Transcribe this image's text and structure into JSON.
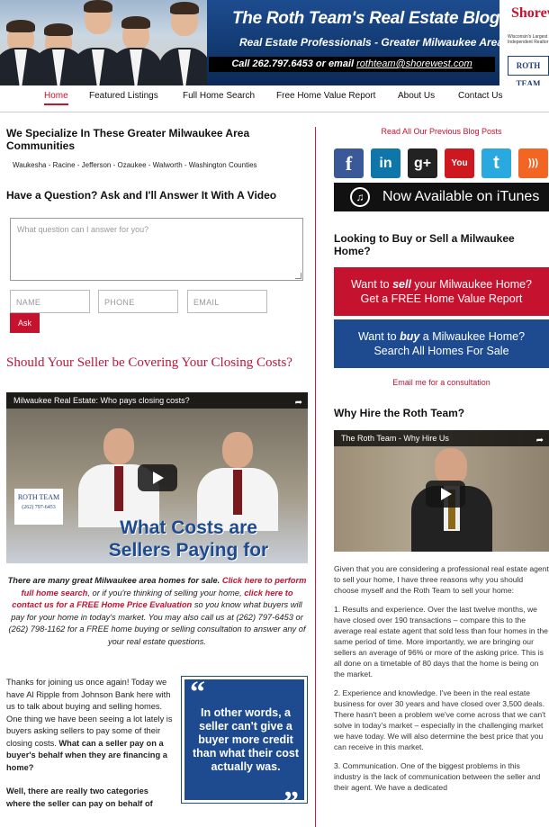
{
  "header": {
    "title": "The Roth Team's Real Estate Blog",
    "subtitle": "Real Estate Professionals - Greater Milwaukee Area",
    "call_prefix": "Call 262.797.6453 or email ",
    "email": "rothteam@shorewest.com",
    "brand_logo": "Shorew",
    "brand_tagline": "Wisconsin's Largest Independent Realtor",
    "team_badge": "ROTH TEAM"
  },
  "nav": {
    "items": [
      "Home",
      "Featured Listings",
      "Full Home Search",
      "Free Home Value Report",
      "About Us",
      "Contact Us"
    ],
    "active_index": 0
  },
  "left": {
    "specialize_heading": "We Specialize In These Greater Milwaukee Area Communities",
    "counties": "Waukesha - Racine - Jefferson - Ozaukee - Walworth - Washington Counties",
    "question_heading": "Have a Question? Ask and I'll Answer It With A Video",
    "question_placeholder": "What question can I answer for you?",
    "name_placeholder": "NAME",
    "phone_placeholder": "PHONE",
    "email_placeholder": "EMAIL",
    "ask_button": "Ask",
    "post_title": "Should Your Seller be Covering Your Closing Costs?",
    "video": {
      "title": "Milwaukee Real Estate: Who pays closing costs?",
      "logo_text": "ROTH TEAM",
      "logo_phone": "(262) 797-6453",
      "caption_line1": "What Costs are",
      "caption_line2": "Sellers Paying for Buyers?"
    },
    "promo": {
      "p1": "There are many great Milwaukee area homes for sale.",
      "link1": "Click here to perform full home search",
      "p2": ", or if you're thinking of selling your home,",
      "link2": "click here to contact us for a FREE Home Price Evaluation",
      "p3": " so you know what buyers will pay for your home in today's market. You may also call us at (262) 797-6453 or (262) 798-1162 for a FREE home buying or selling consultation to answer any of your real estate questions."
    },
    "body": {
      "p1": "Thanks for joining us once again! Today we have Al Ripple from Johnson Bank here with us to talk about buying and selling homes. One thing we have been seeing a lot lately is buyers asking sellers to pay some of their closing costs.",
      "p1_bold": "What can a seller pay on a buyer's behalf when they are financing a home?",
      "p2_bold": "Well, there are really two categories where the seller can pay on behalf of"
    },
    "quote": {
      "open": "“",
      "close": "”",
      "text": "In other words, a seller can't give a buyer more credit than what their cost actually was."
    }
  },
  "right": {
    "previous_posts": "Read All Our Previous Blog Posts",
    "social": [
      {
        "name": "facebook",
        "glyph": "f",
        "color": "#3b5998"
      },
      {
        "name": "linkedin",
        "glyph": "in",
        "color": "#0e76a8"
      },
      {
        "name": "google-plus",
        "glyph": "g+",
        "color": "#222222"
      },
      {
        "name": "youtube",
        "glyph": "You",
        "color": "#cc181e"
      },
      {
        "name": "twitter",
        "glyph": "t",
        "color": "#2aa9e0"
      },
      {
        "name": "rss",
        "glyph": ")))",
        "color": "#f26522"
      }
    ],
    "itunes_text": "Now Available on iTunes",
    "buy_sell_heading": "Looking to Buy or Sell a Milwaukee Home?",
    "sell_cta_a": "Want to ",
    "sell_cta_em": "sell",
    "sell_cta_b": " your Milwaukee Home?",
    "sell_cta_line2": "Get a FREE Home Value Report",
    "buy_cta_a": "Want to ",
    "buy_cta_em": "buy",
    "buy_cta_b": " a Milwaukee Home?",
    "buy_cta_line2": "Search All Homes For Sale",
    "email_link": "Email me for a consultation",
    "why_heading": "Why Hire the Roth Team?",
    "video_title": "The Roth Team - Why Hire Us",
    "paragraphs": [
      "Given that you are considering a professional real estate agent to sell your home, I have three reasons why you should choose myself and the Roth Team to sell your home:",
      "1. Results and experience. Over the last twelve months, we have closed over 190 transactions – compare this to the average real estate agent that sold less than four homes in the same period of time. More importantly, we are bringing our sellers an average of 96% or more of the asking price. This is all done on a timetable of 80 days that the home is being on the market.",
      "2. Experience and knowledge. I've been in the real estate business for over 30 years and have closed over 3,500 deals. There hasn't been a problem we've come across that we can't solve in today's market – especially in the challenging market we have today. We will also determine the best price that you can receive in this market.",
      "3. Communication. One of the biggest problems in this industry is the lack of communication between the seller and their agent. We have a dedicated"
    ]
  },
  "colors": {
    "accent_red": "#c4122f",
    "navy": "#1e4b8f"
  }
}
